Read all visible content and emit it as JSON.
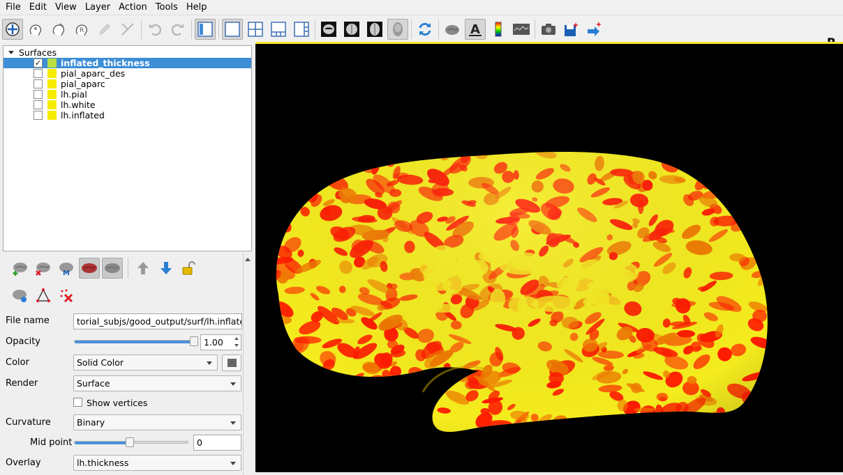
{
  "menu": [
    "File",
    "Edit",
    "View",
    "Layer",
    "Action",
    "Tools",
    "Help"
  ],
  "toolbar": {
    "orientation_label": "R",
    "icons": [
      "navigate-icon",
      "roi-edit-icon",
      "voxel-edit-icon",
      "recon-edit-icon",
      "pencil-icon",
      "measure-icon",
      "undo-icon",
      "redo-icon",
      "layer-panel-icon",
      "layout-1x1-icon",
      "layout-2x2-icon",
      "layout-1-3-icon",
      "layout-1-3-horizontal-icon",
      "sagittal-view-icon",
      "coronal-view-icon",
      "axial-view-icon",
      "3d-view-icon",
      "reset-view-icon",
      "surface-icon",
      "annotation-text-icon",
      "colorbar-icon",
      "cursor-icon",
      "snapshot-icon",
      "save-point-icon",
      "goto-point-icon"
    ]
  },
  "layers": {
    "group_label": "Surfaces",
    "items": [
      {
        "name": "inflated_thickness",
        "checked": true,
        "selected": true,
        "color": "#b8e040"
      },
      {
        "name": "pial_aparc_des",
        "checked": false,
        "selected": false,
        "color": "#f7ec00"
      },
      {
        "name": "pial_aparc",
        "checked": false,
        "selected": false,
        "color": "#f7ec00"
      },
      {
        "name": "lh.pial",
        "checked": false,
        "selected": false,
        "color": "#f7ec00"
      },
      {
        "name": "lh.white",
        "checked": false,
        "selected": false,
        "color": "#f7ec00"
      },
      {
        "name": "lh.inflated",
        "checked": false,
        "selected": false,
        "color": "#f7ec00"
      }
    ]
  },
  "properties": {
    "file_name_label": "File name",
    "file_name_value": "torial_subjs/good_output/surf/lh.inflated",
    "opacity_label": "Opacity",
    "opacity_value": "1.00",
    "opacity_level": 1.0,
    "color_label": "Color",
    "color_value": "Solid Color",
    "render_label": "Render",
    "render_value": "Surface",
    "show_vertices_label": "Show vertices",
    "show_vertices_checked": false,
    "curvature_label": "Curvature",
    "curvature_value": "Binary",
    "midpoint_label": "Mid point",
    "midpoint_value": "0",
    "midpoint_level": 0.5,
    "overlay_label": "Overlay",
    "overlay_value": "lh.thickness"
  },
  "colors": {
    "accent": "#3d8ed6",
    "surface_low": "#f5ec1e",
    "surface_high": "#ff1a00",
    "background_3d": "#000000"
  }
}
